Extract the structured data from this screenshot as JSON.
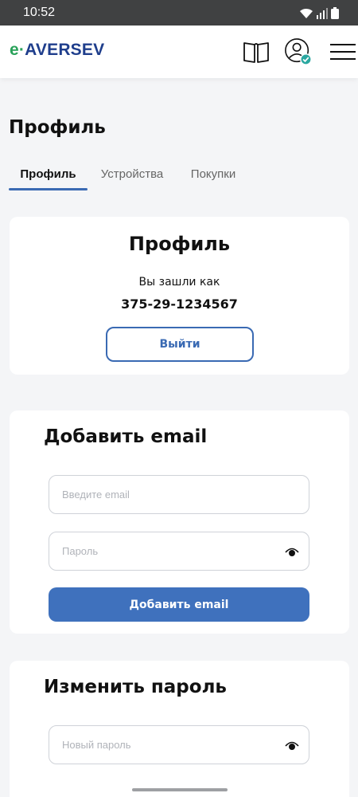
{
  "status_bar": {
    "time": "10:52"
  },
  "header": {
    "logo": {
      "prefix": "e",
      "dot": "·",
      "name": "AVERSEV"
    },
    "icons": {
      "book": "book-icon",
      "profile": "user-icon",
      "menu": "hamburger-menu-icon"
    }
  },
  "page": {
    "title": "Профиль"
  },
  "tabs": [
    {
      "label": "Профиль",
      "active": true
    },
    {
      "label": "Устройства",
      "active": false
    },
    {
      "label": "Покупки",
      "active": false
    }
  ],
  "profile_card": {
    "title": "Профиль",
    "logged_in_label": "Вы зашли как",
    "phone": "375-29-1234567",
    "logout_label": "Выйти"
  },
  "add_email_card": {
    "title": "Добавить email",
    "email_placeholder": "Введите email",
    "password_placeholder": "Пароль",
    "submit_label": "Добавить email"
  },
  "change_password_card": {
    "title": "Изменить пароль",
    "new_password_placeholder": "Новый пароль"
  },
  "colors": {
    "accent": "#3f71bd",
    "logo_green": "#2aa25a",
    "logo_blue": "#1f3e8c"
  }
}
